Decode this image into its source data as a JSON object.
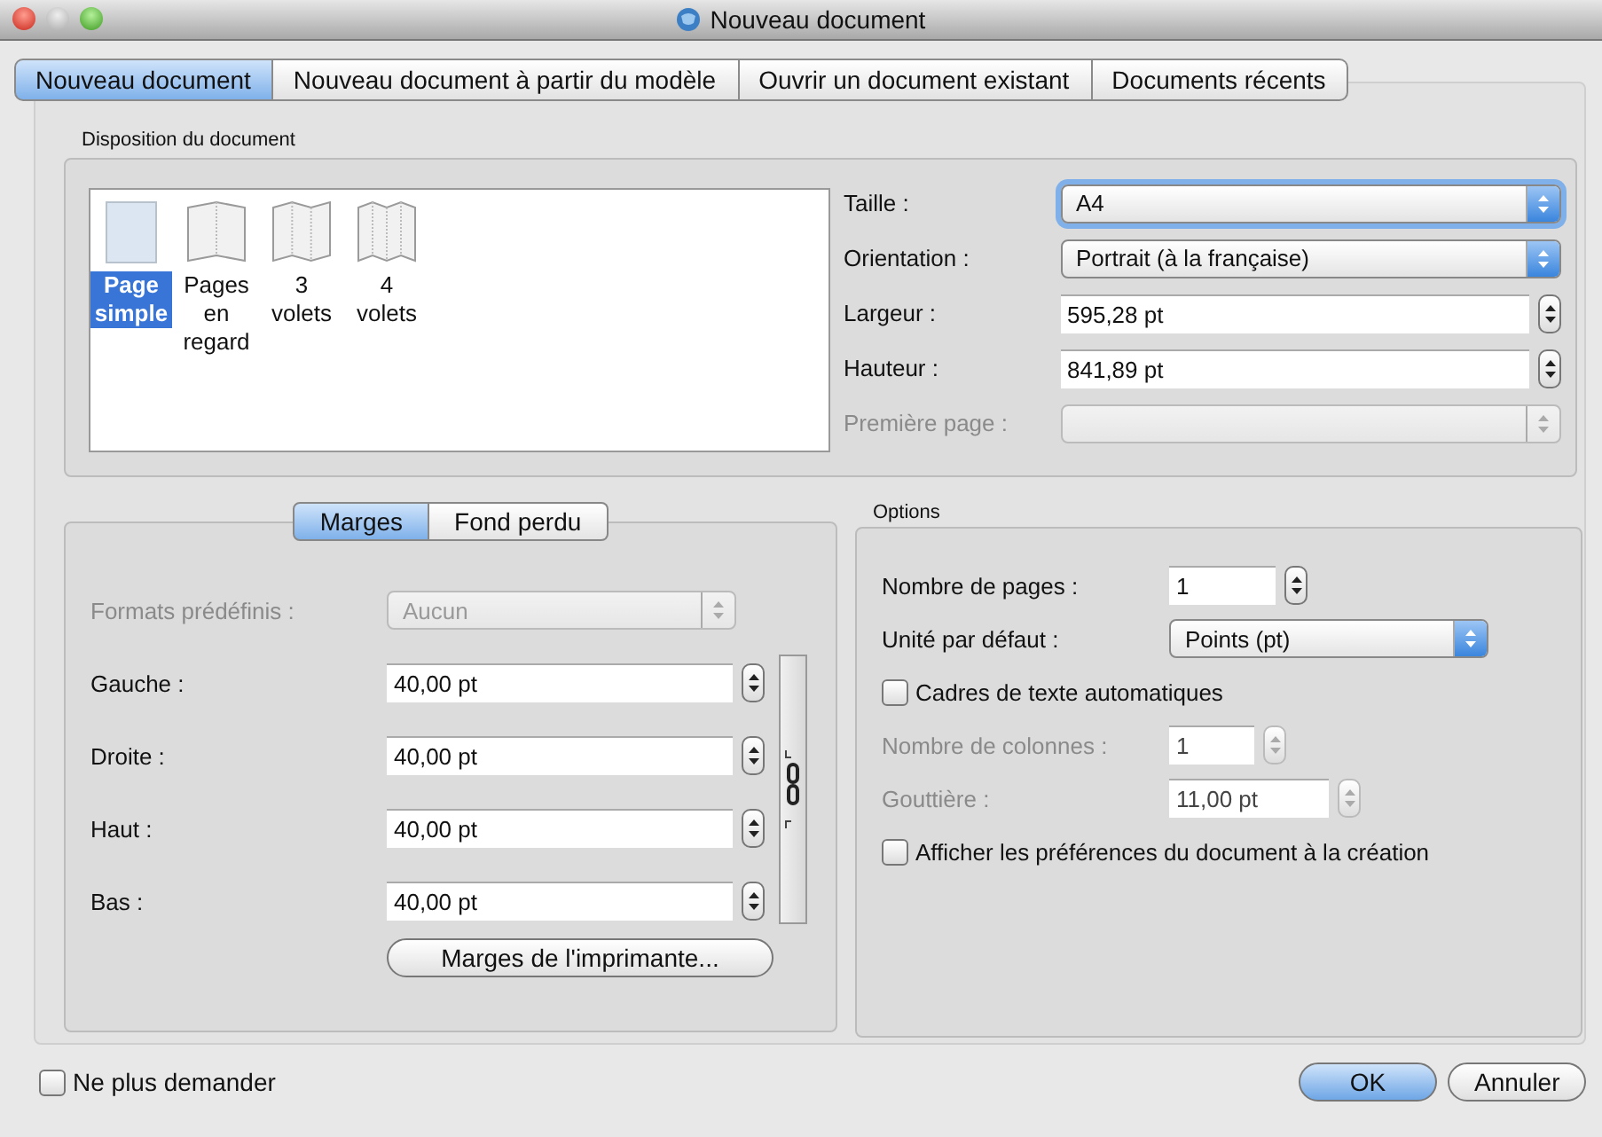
{
  "window": {
    "title": "Nouveau document"
  },
  "tabs": [
    {
      "label": "Nouveau document",
      "selected": true
    },
    {
      "label": "Nouveau document à partir du modèle",
      "selected": false
    },
    {
      "label": "Ouvrir un document existant",
      "selected": false
    },
    {
      "label": "Documents récents",
      "selected": false
    }
  ],
  "layout": {
    "title": "Disposition du document",
    "types": [
      {
        "kind": "single",
        "label": "Page simple",
        "selected": true
      },
      {
        "kind": "facing",
        "label": "Pages en regard",
        "selected": false
      },
      {
        "kind": "tri",
        "label": "3 volets",
        "selected": false
      },
      {
        "kind": "quad",
        "label": "4 volets",
        "selected": false
      }
    ],
    "fields": [
      {
        "kind": "select",
        "label": "Taille :",
        "value": "A4",
        "focused": true,
        "disabled": false
      },
      {
        "kind": "select",
        "label": "Orientation :",
        "value": "Portrait (à la française)",
        "focused": false,
        "disabled": false
      },
      {
        "kind": "stepper",
        "label": "Largeur :",
        "value": "595,28 pt",
        "disabled": false
      },
      {
        "kind": "stepper",
        "label": "Hauteur :",
        "value": "841,89 pt",
        "disabled": false
      },
      {
        "kind": "select",
        "label": "Première page :",
        "focused": false,
        "disabled": true
      }
    ]
  },
  "margins": {
    "tabs": [
      {
        "label": "Marges",
        "selected": true
      },
      {
        "label": "Fond perdu",
        "selected": false
      }
    ],
    "fields": [
      {
        "kind": "select",
        "label": "Formats prédéfinis :",
        "value": "Aucun",
        "focused": false,
        "disabled": true
      },
      {
        "kind": "stepper",
        "label": "Gauche :",
        "value": "40,00 pt",
        "disabled": false
      },
      {
        "kind": "stepper",
        "label": "Droite :",
        "value": "40,00 pt",
        "disabled": false
      },
      {
        "kind": "stepper",
        "label": "Haut :",
        "value": "40,00 pt",
        "disabled": false
      },
      {
        "kind": "stepper",
        "label": "Bas :",
        "value": "40,00 pt",
        "disabled": false
      }
    ],
    "button": "Marges de l'imprimante..."
  },
  "options": {
    "title": "Options",
    "fields": [
      {
        "kind": "stepper",
        "label": "Nombre de pages :",
        "value": "1",
        "disabled": false
      },
      {
        "kind": "select",
        "label": "Unité par défaut :",
        "value": "Points (pt)",
        "focused": false,
        "disabled": false
      },
      {
        "kind": "checkbox",
        "label": "Cadres de texte automatiques",
        "checked": false,
        "disabled": false
      },
      {
        "kind": "stepper",
        "label": "Nombre de colonnes :",
        "value": "1",
        "disabled": true
      },
      {
        "kind": "stepper",
        "label": "Gouttière :",
        "value": "11,00 pt",
        "disabled": true
      },
      {
        "kind": "checkbox",
        "label": "Afficher les préférences du document à la création",
        "checked": false,
        "disabled": false
      }
    ]
  },
  "footer": {
    "checkbox": {
      "label": "Ne plus demander",
      "checked": false
    },
    "buttons": [
      {
        "label": "OK",
        "default": true
      },
      {
        "label": "Annuler",
        "default": false
      }
    ]
  }
}
